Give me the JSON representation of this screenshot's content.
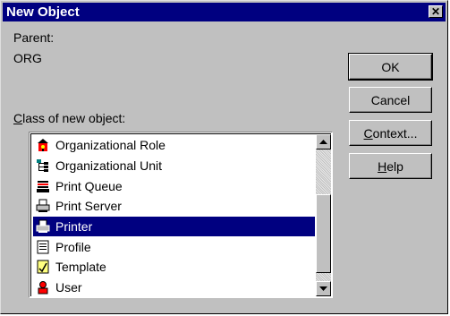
{
  "window": {
    "title": "New Object"
  },
  "parent": {
    "label": "Parent:",
    "value": "ORG"
  },
  "class_label": {
    "accel": "C",
    "rest": "lass of new object:"
  },
  "buttons": {
    "ok": "OK",
    "cancel": "Cancel",
    "context": {
      "accel": "C",
      "rest": "ontext..."
    },
    "help": {
      "accel": "H",
      "rest": "elp"
    }
  },
  "list": {
    "items": [
      {
        "label": "Organizational Role",
        "icon": "organizational-role-icon"
      },
      {
        "label": "Organizational Unit",
        "icon": "organizational-unit-icon"
      },
      {
        "label": "Print Queue",
        "icon": "print-queue-icon"
      },
      {
        "label": "Print Server",
        "icon": "print-server-icon"
      },
      {
        "label": "Printer",
        "icon": "printer-icon",
        "selected": true
      },
      {
        "label": "Profile",
        "icon": "profile-icon"
      },
      {
        "label": "Template",
        "icon": "template-icon"
      },
      {
        "label": "User",
        "icon": "user-icon"
      }
    ],
    "scroll_position": 0.85
  }
}
